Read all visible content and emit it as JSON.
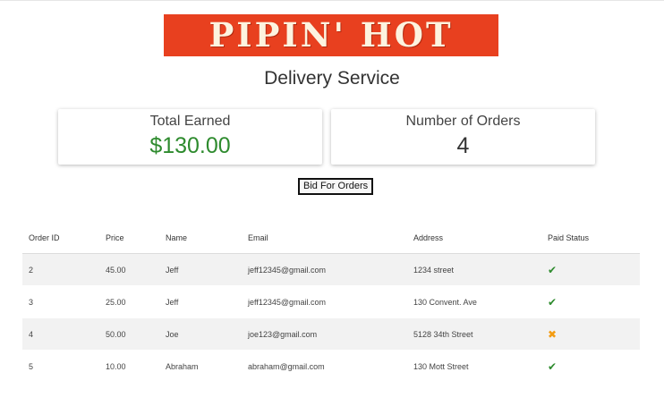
{
  "header": {
    "logo_text": "PIPIN' HOT",
    "subtitle": "Delivery Service"
  },
  "stats": {
    "earned_label": "Total Earned",
    "earned_value": "$130.00",
    "orders_label": "Number of Orders",
    "orders_value": "4"
  },
  "actions": {
    "bid_label": "Bid For Orders"
  },
  "colors": {
    "brand": "#e8401f",
    "money": "#2e8b2e",
    "paid": "#2e8b2e",
    "unpaid": "#f39c12"
  },
  "table": {
    "headers": [
      "Order ID",
      "Price",
      "Name",
      "Email",
      "Address",
      "Paid Status"
    ],
    "rows": [
      {
        "id": "2",
        "price": "45.00",
        "name": "Jeff",
        "email": "jeff12345@gmail.com",
        "address": "1234 street",
        "paid": "check-icon"
      },
      {
        "id": "3",
        "price": "25.00",
        "name": "Jeff",
        "email": "jeff12345@gmail.com",
        "address": "130 Convent. Ave",
        "paid": "check-icon"
      },
      {
        "id": "4",
        "price": "50.00",
        "name": "Joe",
        "email": "joe123@gmail.com",
        "address": "5128 34th Street",
        "paid": "x-icon"
      },
      {
        "id": "5",
        "price": "10.00",
        "name": "Abraham",
        "email": "abraham@gmail.com",
        "address": "130 Mott Street",
        "paid": "check-icon"
      }
    ]
  }
}
